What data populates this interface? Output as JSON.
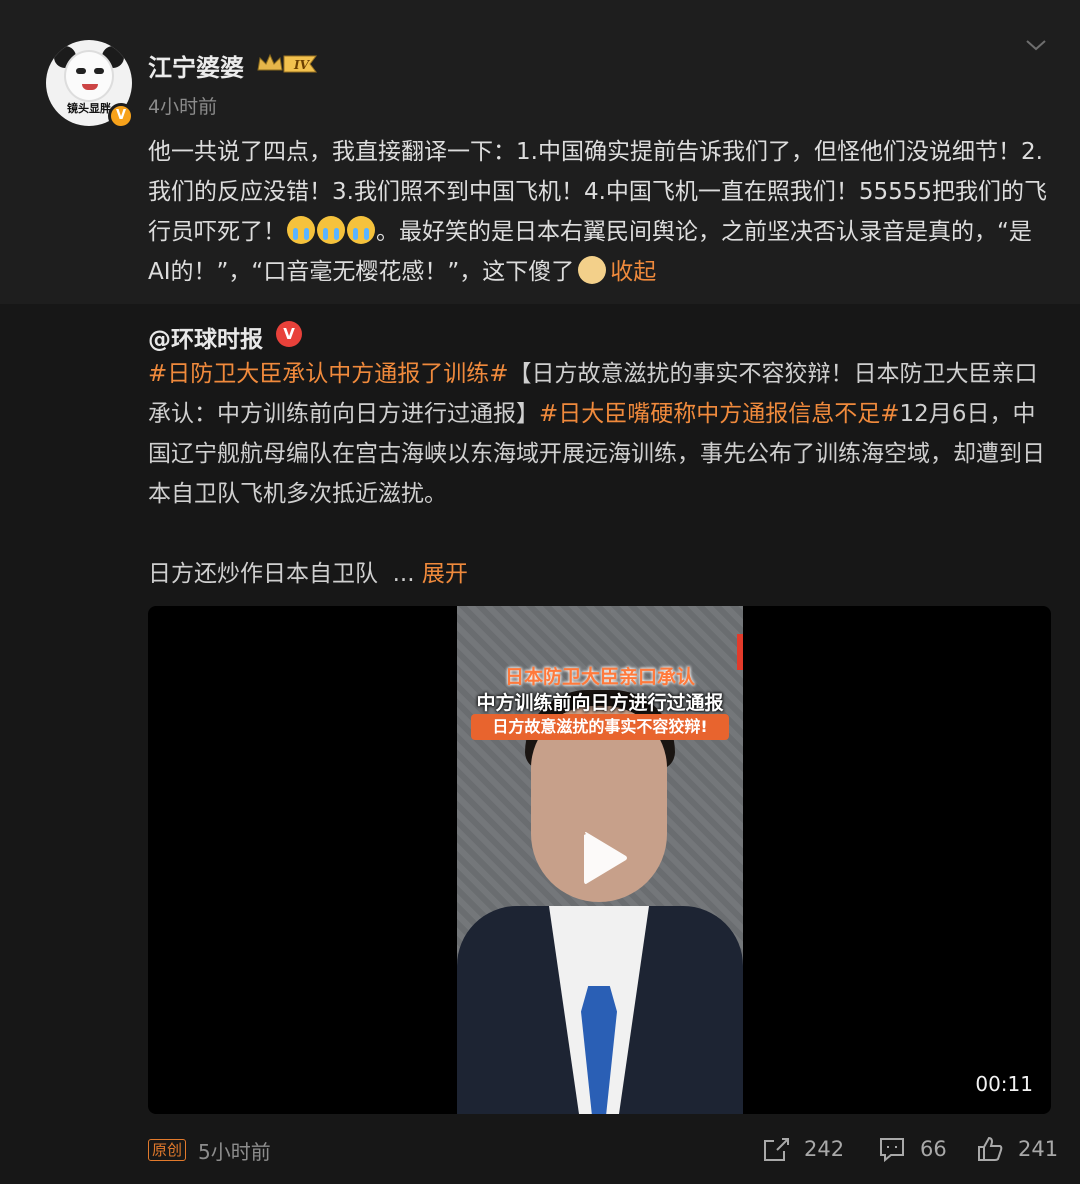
{
  "post": {
    "username": "江宁婆婆",
    "level_badge": "IV",
    "avatar_caption": "镜头显胖",
    "time": "4小时前",
    "text_main": "他一共说了四点，我直接翻译一下：1.中国确实提前告诉我们了，但怪他们没说细节！2.我们的反应没错！3.我们照不到中国飞机！4.中国飞机一直在照我们！55555把我们的飞行员吓死了！",
    "text_tail": "。最好笑的是日本右翼民间舆论，之前坚决否认录音是真的，“是AI的！”，“口音毫无樱花感！”，这下傻了",
    "collapse_label": "收起"
  },
  "repost": {
    "author": "@环球时报",
    "verified_icon": "V",
    "hashtag1": "#日防卫大臣承认中方通报了训练#",
    "text1": "【日方故意滋扰的事实不容狡辩！日本防卫大臣亲口承认：中方训练前向日方进行过通报】",
    "hashtag2": "#日大臣嘴硬称中方通报信息不足#",
    "text2": "12月6日，中国辽宁舰航母编队在宫古海峡以东海域开展远海训练，事先公布了训练海空域，却遭到日本自卫队飞机多次抵近滋扰。",
    "more_text": "日方还炒作日本自卫队",
    "ellipsis": "...",
    "expand_label": "展开"
  },
  "video": {
    "caption_line1": "日本防卫大臣亲口承认",
    "caption_line2": "中方训练前向日方进行过通报",
    "caption_line3": "日方故意滋扰的事实不容狡辩!",
    "duration": "00:11"
  },
  "footer": {
    "original_badge": "原创",
    "time": "5小时前",
    "shares": "242",
    "comments": "66",
    "likes": "241"
  },
  "colors": {
    "accent_orange": "#f08a3c",
    "verified_red": "#e8413a",
    "verified_orange": "#f7a21b"
  },
  "icons": [
    "chevron-down-icon",
    "share-icon",
    "comment-icon",
    "like-icon",
    "play-icon"
  ]
}
